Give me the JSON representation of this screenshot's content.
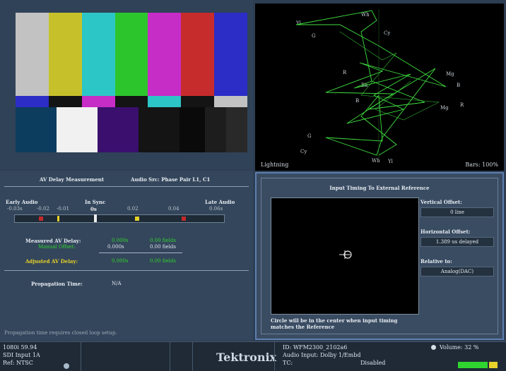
{
  "colors": {
    "accent": "#5d7fb0",
    "trace": "#3fe03f",
    "green": "#2fd42f",
    "yellow": "#e6d22a"
  },
  "picture": {
    "top_bars": [
      "#c2c2c2",
      "#c6c12b",
      "#2cc6c6",
      "#2cc62c",
      "#c62cc6",
      "#c62c2c",
      "#2c2cc6"
    ],
    "mid_bars": [
      "#2c2cc6",
      "#141414",
      "#c62cc6",
      "#141414",
      "#2cc6c6",
      "#141414",
      "#c2c2c2"
    ],
    "bottom_blocks": [
      "#0c3c5e",
      "#f1f1f1",
      "#3a0f6e",
      "#141414",
      "#0a0a0a",
      "#1d1d1d",
      "#292929"
    ]
  },
  "lightning": {
    "label": "Lightning",
    "bars_label": "Bars: 100%",
    "targets": [
      "Yl",
      "G",
      "Wh",
      "Cy",
      "R",
      "Mg",
      "B",
      "Bk",
      "B",
      "Mg",
      "G",
      "Cy",
      "Wh",
      "Yl",
      "R"
    ]
  },
  "av": {
    "title": "AV Delay Measurement",
    "audio_src": "Audio Src: Phase Pair  L1, C1",
    "early": "Early Audio",
    "in_sync": "In Sync",
    "late": "Late Audio",
    "ticks": [
      "-0.03s",
      "-0.02",
      "-0.01",
      "0s",
      "0.02",
      "0.04",
      "0.06s"
    ],
    "measured_label": "Measured AV Delay:",
    "measured_val": "0.000s",
    "measured_fields": "0.00 fields",
    "manual_label": "Manual Offset:",
    "manual_val": "0.000s",
    "manual_fields": "0.00 fields",
    "adjusted_label": "Adjusted AV Delay:",
    "adjusted_val": "0.000s",
    "adjusted_fields": "0.00 fields",
    "prop_label": "Propagation Time:",
    "prop_val": "N/A",
    "footnote": "Propagation time requires closed loop setup."
  },
  "timing": {
    "title": "Input Timing To External Reference",
    "vertical_label": "Vertical Offset:",
    "vertical_val": "0 line",
    "horizontal_label": "Horizontal Offset:",
    "horizontal_val": "1.389 us delayed",
    "relative_label": "Relative to:",
    "relative_val": "Analog(DAC)",
    "note": "Circle will be in the center when input timing matches the Reference"
  },
  "status": {
    "format": "1080i 59.94",
    "input": "SDI Input 1A",
    "ref": "Ref: NTSC",
    "brand": "Tektronix",
    "id": "ID: WFM2300_2102a6",
    "audio_input": "Audio Input: Dolby 1/Embd",
    "tc_label": "TC:",
    "tc_val": "Disabled",
    "volume": "Volume:  32 %"
  }
}
